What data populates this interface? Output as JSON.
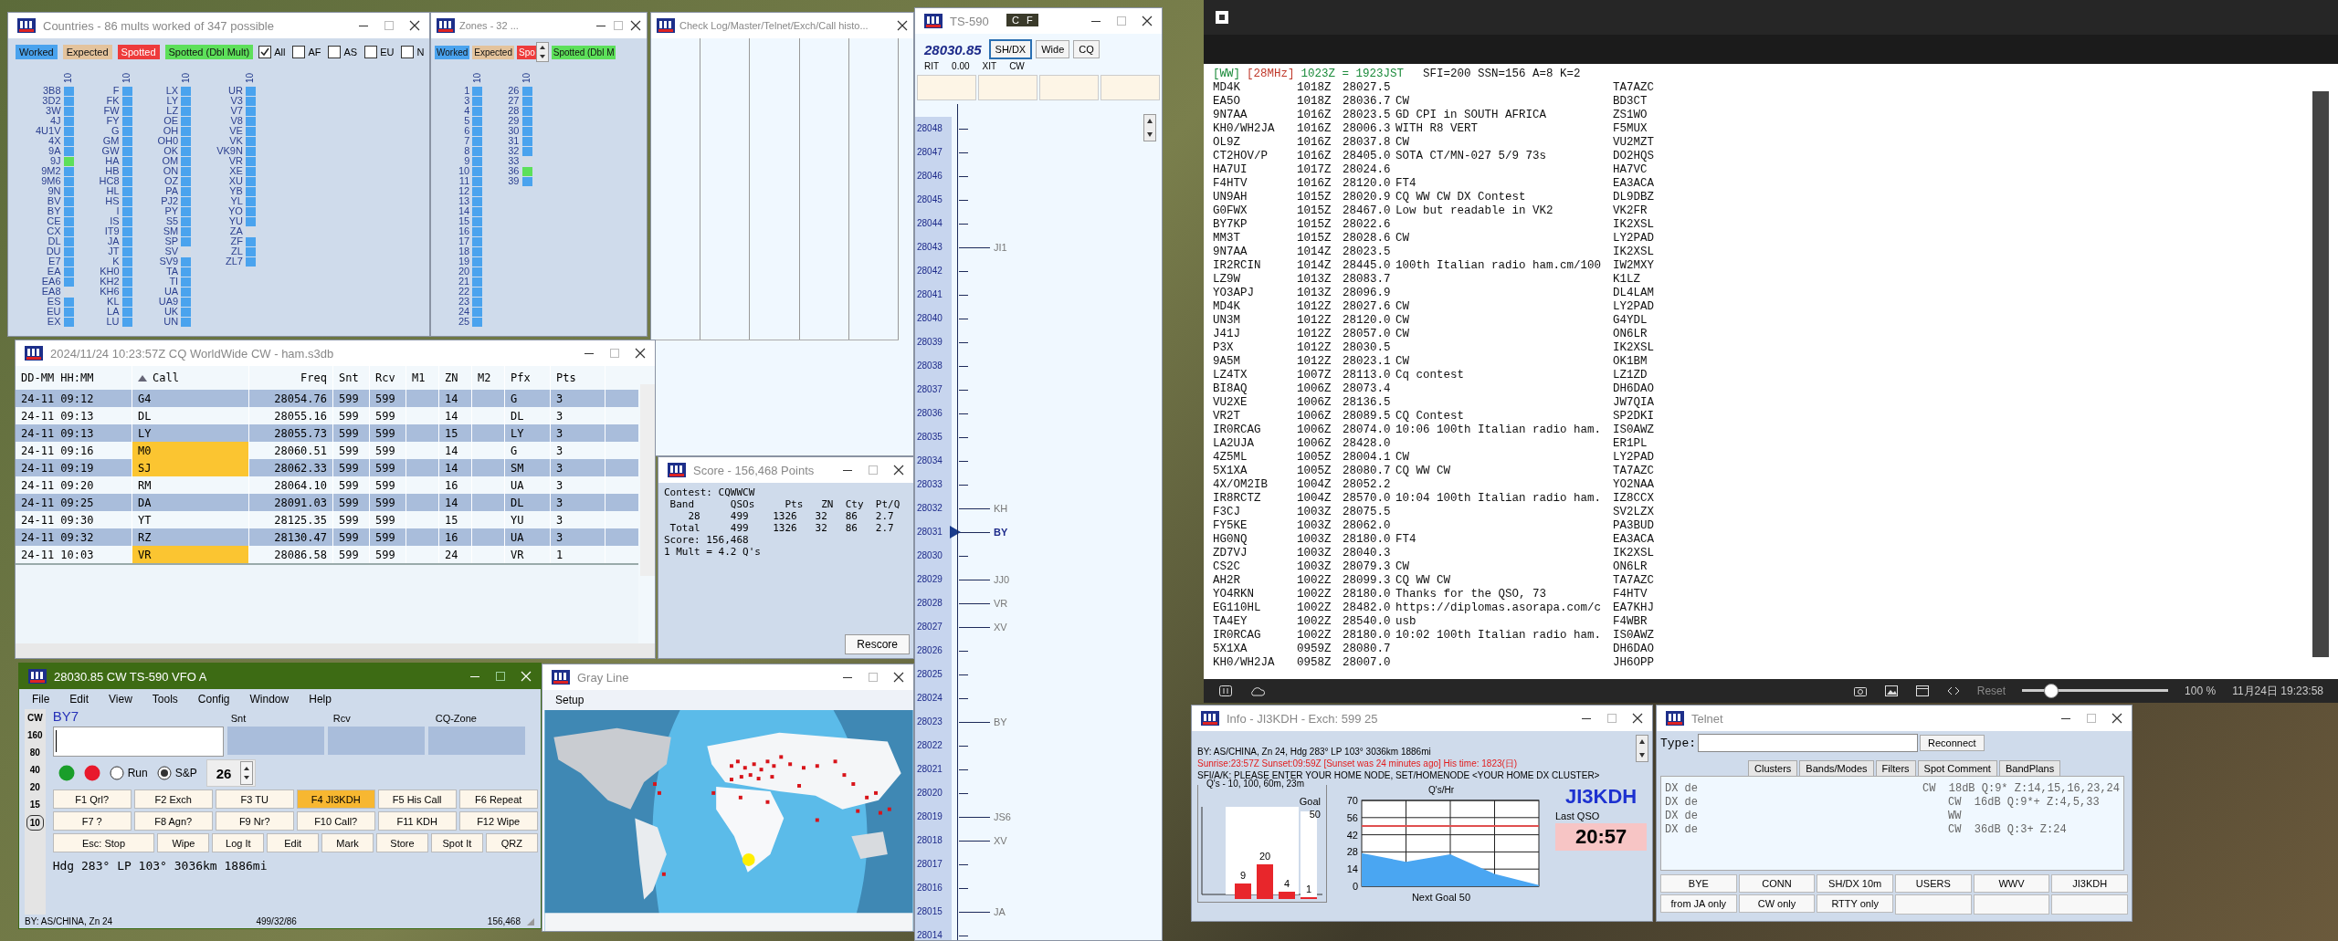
{
  "countries_window": {
    "title": "Countries - 86 mults worked of 347 possible",
    "active": false,
    "legend": [
      {
        "label": "Worked",
        "kind": "worked"
      },
      {
        "label": "Expected",
        "kind": "expected"
      },
      {
        "label": "Spotted",
        "kind": "spotted"
      },
      {
        "label": "Spotted (Dbl Mult)",
        "kind": "spotted_dbl"
      }
    ],
    "filters": [
      {
        "label": "All",
        "checked": true
      },
      {
        "label": "AF",
        "checked": false
      },
      {
        "label": "AS",
        "checked": false
      },
      {
        "label": "EU",
        "checked": false
      },
      {
        "label": "N",
        "checked": false
      }
    ],
    "columns": [
      {
        "header": "10",
        "items": [
          {
            "name": "3B8",
            "color": "#4aa3ee"
          },
          {
            "name": "3D2",
            "color": "#4aa3ee"
          },
          {
            "name": "3W",
            "color": "#4aa3ee"
          },
          {
            "name": "4J",
            "color": "#4aa3ee"
          },
          {
            "name": "4U1V",
            "color": "#4aa3ee"
          },
          {
            "name": "4X",
            "color": "#4aa3ee"
          },
          {
            "name": "9A",
            "color": "#4aa3ee"
          },
          {
            "name": "9J",
            "color": "#5de05a"
          },
          {
            "name": "9M2",
            "color": "#4aa3ee"
          },
          {
            "name": "9M6",
            "color": "#4aa3ee"
          },
          {
            "name": "9N",
            "color": "#4aa3ee"
          },
          {
            "name": "BV",
            "color": "#4aa3ee"
          },
          {
            "name": "BY",
            "color": "#4aa3ee"
          },
          {
            "name": "CE",
            "color": "#4aa3ee"
          },
          {
            "name": "CX",
            "color": "#4aa3ee"
          },
          {
            "name": "DL",
            "color": "#4aa3ee"
          },
          {
            "name": "DU",
            "color": "#4aa3ee"
          },
          {
            "name": "E7",
            "color": "#4aa3ee"
          },
          {
            "name": "EA",
            "color": "#4aa3ee"
          },
          {
            "name": "EA6",
            "color": "#4aa3ee"
          },
          {
            "name": "EA8",
            "color": "#d3dbe6"
          },
          {
            "name": "ES",
            "color": "#4aa3ee"
          },
          {
            "name": "EU",
            "color": "#4aa3ee"
          },
          {
            "name": "EX",
            "color": "#4aa3ee"
          }
        ]
      },
      {
        "header": "10",
        "items": [
          {
            "name": "F",
            "color": "#4aa3ee"
          },
          {
            "name": "FK",
            "color": "#4aa3ee"
          },
          {
            "name": "FW",
            "color": "#4aa3ee"
          },
          {
            "name": "FY",
            "color": "#4aa3ee"
          },
          {
            "name": "G",
            "color": "#4aa3ee"
          },
          {
            "name": "GM",
            "color": "#4aa3ee"
          },
          {
            "name": "GW",
            "color": "#4aa3ee"
          },
          {
            "name": "HA",
            "color": "#4aa3ee"
          },
          {
            "name": "HB",
            "color": "#4aa3ee"
          },
          {
            "name": "HC8",
            "color": "#4aa3ee"
          },
          {
            "name": "HL",
            "color": "#4aa3ee"
          },
          {
            "name": "HS",
            "color": "#4aa3ee"
          },
          {
            "name": "I",
            "color": "#4aa3ee"
          },
          {
            "name": "IS",
            "color": "#4aa3ee"
          },
          {
            "name": "IT9",
            "color": "#4aa3ee"
          },
          {
            "name": "JA",
            "color": "#4aa3ee"
          },
          {
            "name": "JT",
            "color": "#4aa3ee"
          },
          {
            "name": "K",
            "color": "#4aa3ee"
          },
          {
            "name": "KH0",
            "color": "#4aa3ee"
          },
          {
            "name": "KH2",
            "color": "#4aa3ee"
          },
          {
            "name": "KH6",
            "color": "#4aa3ee"
          },
          {
            "name": "KL",
            "color": "#4aa3ee"
          },
          {
            "name": "LA",
            "color": "#4aa3ee"
          },
          {
            "name": "LU",
            "color": "#4aa3ee"
          }
        ]
      },
      {
        "header": "10",
        "items": [
          {
            "name": "LX",
            "color": "#4aa3ee"
          },
          {
            "name": "LY",
            "color": "#4aa3ee"
          },
          {
            "name": "LZ",
            "color": "#4aa3ee"
          },
          {
            "name": "OE",
            "color": "#4aa3ee"
          },
          {
            "name": "OH",
            "color": "#4aa3ee"
          },
          {
            "name": "OH0",
            "color": "#4aa3ee"
          },
          {
            "name": "OK",
            "color": "#4aa3ee"
          },
          {
            "name": "OM",
            "color": "#4aa3ee"
          },
          {
            "name": "ON",
            "color": "#4aa3ee"
          },
          {
            "name": "OZ",
            "color": "#4aa3ee"
          },
          {
            "name": "PA",
            "color": "#4aa3ee"
          },
          {
            "name": "PJ2",
            "color": "#4aa3ee"
          },
          {
            "name": "PY",
            "color": "#4aa3ee"
          },
          {
            "name": "S5",
            "color": "#4aa3ee"
          },
          {
            "name": "SM",
            "color": "#4aa3ee"
          },
          {
            "name": "SP",
            "color": "#4aa3ee"
          },
          {
            "name": "SV",
            "color": "#d3dbe6"
          },
          {
            "name": "SV9",
            "color": "#4aa3ee"
          },
          {
            "name": "TA",
            "color": "#4aa3ee"
          },
          {
            "name": "TI",
            "color": "#4aa3ee"
          },
          {
            "name": "UA",
            "color": "#4aa3ee"
          },
          {
            "name": "UA9",
            "color": "#4aa3ee"
          },
          {
            "name": "UK",
            "color": "#4aa3ee"
          },
          {
            "name": "UN",
            "color": "#4aa3ee"
          }
        ]
      },
      {
        "header": "10",
        "items": [
          {
            "name": "UR",
            "color": "#4aa3ee"
          },
          {
            "name": "V3",
            "color": "#4aa3ee"
          },
          {
            "name": "V7",
            "color": "#4aa3ee"
          },
          {
            "name": "V8",
            "color": "#4aa3ee"
          },
          {
            "name": "VE",
            "color": "#4aa3ee"
          },
          {
            "name": "VK",
            "color": "#4aa3ee"
          },
          {
            "name": "VK9N",
            "color": "#4aa3ee"
          },
          {
            "name": "VR",
            "color": "#4aa3ee"
          },
          {
            "name": "XE",
            "color": "#4aa3ee"
          },
          {
            "name": "XU",
            "color": "#4aa3ee"
          },
          {
            "name": "YB",
            "color": "#4aa3ee"
          },
          {
            "name": "YL",
            "color": "#4aa3ee"
          },
          {
            "name": "YO",
            "color": "#4aa3ee"
          },
          {
            "name": "YU",
            "color": "#4aa3ee"
          },
          {
            "name": "ZA",
            "color": "#d3dbe6"
          },
          {
            "name": "ZF",
            "color": "#4aa3ee"
          },
          {
            "name": "ZL",
            "color": "#4aa3ee"
          },
          {
            "name": "ZL7",
            "color": "#4aa3ee"
          }
        ]
      }
    ]
  },
  "zones_window": {
    "title": "Zones - 32 ...",
    "active": false,
    "legend": [
      {
        "label": "Worked",
        "kind": "worked"
      },
      {
        "label": "Expected",
        "kind": "expected"
      },
      {
        "label": "Spo",
        "kind": "spotted"
      },
      {
        "label": "Spotted (Dbl M",
        "kind": "spotted_dbl"
      }
    ],
    "columns": [
      {
        "header": "10",
        "items": [
          {
            "name": "1",
            "color": "#4aa3ee"
          },
          {
            "name": "3",
            "color": "#4aa3ee"
          },
          {
            "name": "4",
            "color": "#4aa3ee"
          },
          {
            "name": "5",
            "color": "#4aa3ee"
          },
          {
            "name": "6",
            "color": "#4aa3ee"
          },
          {
            "name": "7",
            "color": "#4aa3ee"
          },
          {
            "name": "8",
            "color": "#4aa3ee"
          },
          {
            "name": "9",
            "color": "#4aa3ee"
          },
          {
            "name": "10",
            "color": "#4aa3ee"
          },
          {
            "name": "11",
            "color": "#4aa3ee"
          },
          {
            "name": "12",
            "color": "#4aa3ee"
          },
          {
            "name": "13",
            "color": "#4aa3ee"
          },
          {
            "name": "14",
            "color": "#4aa3ee"
          },
          {
            "name": "15",
            "color": "#4aa3ee"
          },
          {
            "name": "16",
            "color": "#4aa3ee"
          },
          {
            "name": "17",
            "color": "#4aa3ee"
          },
          {
            "name": "18",
            "color": "#4aa3ee"
          },
          {
            "name": "19",
            "color": "#4aa3ee"
          },
          {
            "name": "20",
            "color": "#4aa3ee"
          },
          {
            "name": "21",
            "color": "#4aa3ee"
          },
          {
            "name": "22",
            "color": "#4aa3ee"
          },
          {
            "name": "23",
            "color": "#4aa3ee"
          },
          {
            "name": "24",
            "color": "#4aa3ee"
          },
          {
            "name": "25",
            "color": "#4aa3ee"
          }
        ]
      },
      {
        "header": "10",
        "items": [
          {
            "name": "26",
            "color": "#4aa3ee"
          },
          {
            "name": "27",
            "color": "#4aa3ee"
          },
          {
            "name": "28",
            "color": "#4aa3ee"
          },
          {
            "name": "29",
            "color": "#4aa3ee"
          },
          {
            "name": "30",
            "color": "#4aa3ee"
          },
          {
            "name": "31",
            "color": "#4aa3ee"
          },
          {
            "name": "32",
            "color": "#4aa3ee"
          },
          {
            "name": "33",
            "color": "#d3dbe6"
          },
          {
            "name": "36",
            "color": "#5de05a"
          },
          {
            "name": "39",
            "color": "#4aa3ee"
          }
        ]
      }
    ]
  },
  "check_log_window": {
    "title": "Check Log/Master/Telnet/Exch/Call histo...",
    "active": false
  },
  "log_window": {
    "title": "2024/11/24 10:23:57Z  CQ WorldWide CW - ham.s3db",
    "active": false,
    "columns": [
      "DD-MM HH:MM",
      "Call",
      "Freq",
      "Snt",
      "Rcv",
      "M1",
      "ZN",
      "M2",
      "Pfx",
      "Pts"
    ],
    "rows": [
      {
        "time": "24-11 09:12",
        "call": "G4",
        "highlighted": false,
        "freq": "28054.76",
        "snt": "599",
        "rcv": "599",
        "zn": "14",
        "pfx": "G",
        "pts": "3"
      },
      {
        "time": "24-11 09:13",
        "call": "DL",
        "highlighted": false,
        "freq": "28055.16",
        "snt": "599",
        "rcv": "599",
        "zn": "14",
        "pfx": "DL",
        "pts": "3"
      },
      {
        "time": "24-11 09:13",
        "call": "LY",
        "highlighted": false,
        "freq": "28055.73",
        "snt": "599",
        "rcv": "599",
        "zn": "15",
        "pfx": "LY",
        "pts": "3"
      },
      {
        "time": "24-11 09:16",
        "call": "M0",
        "highlighted": true,
        "freq": "28060.51",
        "snt": "599",
        "rcv": "599",
        "zn": "14",
        "pfx": "G",
        "pts": "3"
      },
      {
        "time": "24-11 09:19",
        "call": "SJ",
        "highlighted": true,
        "freq": "28062.33",
        "snt": "599",
        "rcv": "599",
        "zn": "14",
        "pfx": "SM",
        "pts": "3"
      },
      {
        "time": "24-11 09:20",
        "call": "RM",
        "highlighted": false,
        "freq": "28064.10",
        "snt": "599",
        "rcv": "599",
        "zn": "16",
        "pfx": "UA",
        "pts": "3"
      },
      {
        "time": "24-11 09:25",
        "call": "DA",
        "highlighted": false,
        "freq": "28091.03",
        "snt": "599",
        "rcv": "599",
        "zn": "14",
        "pfx": "DL",
        "pts": "3"
      },
      {
        "time": "24-11 09:30",
        "call": "YT",
        "highlighted": false,
        "freq": "28125.35",
        "snt": "599",
        "rcv": "599",
        "zn": "15",
        "pfx": "YU",
        "pts": "3"
      },
      {
        "time": "24-11 09:32",
        "call": "RZ",
        "highlighted": false,
        "freq": "28130.47",
        "snt": "599",
        "rcv": "599",
        "zn": "16",
        "pfx": "UA",
        "pts": "3"
      },
      {
        "time": "24-11 10:03",
        "call": "VR",
        "highlighted": true,
        "freq": "28086.58",
        "snt": "599",
        "rcv": "599",
        "zn": "24",
        "pfx": "VR",
        "pts": "1"
      }
    ]
  },
  "score_window": {
    "title": "Score - 156,468 Points",
    "active": false,
    "lines": [
      "Contest: CQWWCW",
      " Band      QSOs     Pts   ZN  Cty  Pt/Q",
      "    28     499    1326   32   86   2.7",
      " Total     499    1326   32   86   2.7",
      "Score: 156,468",
      "1 Mult = 4.2 Q's"
    ],
    "button": "Rescore"
  },
  "entry_window": {
    "title": "28030.85 CW TS-590 VFO A",
    "active": true,
    "menu": [
      "File",
      "Edit",
      "View",
      "Tools",
      "Config",
      "Window",
      "Help"
    ],
    "bands": [
      {
        "label": "CW",
        "selected": false
      },
      {
        "label": "160",
        "selected": false
      },
      {
        "label": "80",
        "selected": false
      },
      {
        "label": "40",
        "selected": false
      },
      {
        "label": "20",
        "selected": false
      },
      {
        "label": "15",
        "selected": false
      },
      {
        "label": "10",
        "selected": true
      }
    ],
    "call_label": "BY7",
    "field_labels": [
      "Snt",
      "Rcv",
      "CQ-Zone"
    ],
    "lights": [
      {
        "color": "#1a9e2a"
      },
      {
        "color": "#e8192c"
      }
    ],
    "modes": [
      {
        "label": "Run",
        "selected": false
      },
      {
        "label": "S&P",
        "selected": true
      }
    ],
    "spinner": "26",
    "key_rows": [
      {
        "keys": [
          {
            "label": "F1 Qrl?",
            "highlighted": false
          },
          {
            "label": "F2 Exch",
            "highlighted": false
          },
          {
            "label": "F3 TU",
            "highlighted": false
          },
          {
            "label": "F4 JI3KDH",
            "highlighted": true
          },
          {
            "label": "F5 His Call",
            "highlighted": false
          },
          {
            "label": "F6 Repeat",
            "highlighted": false
          }
        ]
      },
      {
        "keys": [
          {
            "label": "F7 ?",
            "highlighted": false
          },
          {
            "label": "F8 Agn?",
            "highlighted": false
          },
          {
            "label": "F9 Nr?",
            "highlighted": false
          },
          {
            "label": "F10 Call?",
            "highlighted": false
          },
          {
            "label": "F11 KDH",
            "highlighted": false
          },
          {
            "label": "F12 Wipe",
            "highlighted": false
          }
        ]
      },
      {
        "keys": [
          {
            "label": "Esc: Stop",
            "highlighted": false
          },
          {
            "label": "Wipe",
            "highlighted": false
          },
          {
            "label": "Log It",
            "highlighted": false
          },
          {
            "label": "Edit",
            "highlighted": false
          },
          {
            "label": "Mark",
            "highlighted": false
          },
          {
            "label": "Store",
            "highlighted": false
          },
          {
            "label": "Spot It",
            "highlighted": false
          },
          {
            "label": "QRZ",
            "highlighted": false
          }
        ]
      }
    ],
    "heading": "Hdg 283° LP 103° 3036km 1886mi",
    "status": [
      "BY: AS/CHINA, Zn 24",
      "499/32/86",
      "156,468"
    ]
  },
  "grayline_window": {
    "title": "Gray Line",
    "active": false,
    "menu": [
      "Setup"
    ]
  },
  "bandmap_window": {
    "title": "TS-590",
    "active": false,
    "tooltip": [
      "C",
      "F"
    ],
    "freq": "28030.85",
    "buttons": [
      {
        "label": "SH/DX",
        "selected": true
      },
      {
        "label": "Wide",
        "selected": false
      },
      {
        "label": "CQ",
        "selected": false
      }
    ],
    "rit": [
      "RIT",
      "0.00",
      "XIT",
      "CW"
    ],
    "ticks": [
      {
        "freq": "28048"
      },
      {
        "freq": "28047"
      },
      {
        "freq": "28046"
      },
      {
        "freq": "28045"
      },
      {
        "freq": "28044"
      },
      {
        "freq": "28043",
        "spot": "JI1",
        "current": false
      },
      {
        "freq": "28042"
      },
      {
        "freq": "28041"
      },
      {
        "freq": "28040"
      },
      {
        "freq": "28039"
      },
      {
        "freq": "28038"
      },
      {
        "freq": "28037"
      },
      {
        "freq": "28036"
      },
      {
        "freq": "28035"
      },
      {
        "freq": "28034"
      },
      {
        "freq": "28033"
      },
      {
        "freq": "28032",
        "spot": "KH",
        "current": false
      },
      {
        "freq": "28031",
        "spot": "BY",
        "current": true
      },
      {
        "freq": "28030"
      },
      {
        "freq": "28029",
        "spot": "JJ0",
        "current": false
      },
      {
        "freq": "28028",
        "spot": "VR",
        "current": false
      },
      {
        "freq": "28027",
        "spot": "XV",
        "current": false
      },
      {
        "freq": "28026"
      },
      {
        "freq": "28025"
      },
      {
        "freq": "28024"
      },
      {
        "freq": "28023",
        "spot": "BY",
        "current": false
      },
      {
        "freq": "28022"
      },
      {
        "freq": "28021"
      },
      {
        "freq": "28020"
      },
      {
        "freq": "28019",
        "spot": "JS6",
        "current": false
      },
      {
        "freq": "28018",
        "spot": "XV",
        "current": false
      },
      {
        "freq": "28017"
      },
      {
        "freq": "28016"
      },
      {
        "freq": "28015",
        "spot": "JA",
        "current": false
      },
      {
        "freq": "28014"
      }
    ]
  },
  "spots_window": {
    "header": {
      "tag": "[WW]",
      "band": "[28MHz]",
      "time": "1023Z = 1923JST",
      "solar": "SFI=200 SSN=156 A=8 K=2"
    },
    "rows": [
      {
        "call": "MD4K",
        "time": "1018Z",
        "freq": "28027.5",
        "spotter": "TA7AZC"
      },
      {
        "call": "EA5O",
        "time": "1018Z",
        "freq": "28036.7",
        "comment": "CW",
        "spotter": "BD3CT"
      },
      {
        "call": "9N7AA",
        "time": "1016Z",
        "freq": "28023.5",
        "comment": "GD CPI in SOUTH AFRICA",
        "spotter": "ZS1WO"
      },
      {
        "call": "KH0/WH2JA",
        "time": "1016Z",
        "freq": "28006.3",
        "comment": "WITH R8 VERT",
        "spotter": "F5MUX"
      },
      {
        "call": "OL9Z",
        "time": "1016Z",
        "freq": "28037.8",
        "comment": "CW",
        "spotter": "VU2MZT"
      },
      {
        "call": "CT2HOV/P",
        "time": "1016Z",
        "freq": "28405.0",
        "comment": "SOTA CT/MN-027 5/9 73s",
        "spotter": "DO2HQS"
      },
      {
        "call": "HA7UI",
        "time": "1017Z",
        "freq": "28024.6",
        "spotter": "HA7VC"
      },
      {
        "call": "F4HTV",
        "time": "1016Z",
        "freq": "28120.0",
        "comment": "FT4",
        "spotter": "EA3ACA"
      },
      {
        "call": "UN9AH",
        "time": "1015Z",
        "freq": "28020.9",
        "comment": "CQ WW CW DX Contest",
        "spotter": "DL9DBZ"
      },
      {
        "call": "G0FWX",
        "time": "1015Z",
        "freq": "28467.0",
        "comment": "Low but readable in VK2",
        "spotter": "VK2FR"
      },
      {
        "call": "BY7KP",
        "time": "1015Z",
        "freq": "28022.6",
        "spotter": "IK2XSL"
      },
      {
        "call": "MM3T",
        "time": "1015Z",
        "freq": "28028.6",
        "comment": "CW",
        "spotter": "LY2PAD"
      },
      {
        "call": "9N7AA",
        "time": "1014Z",
        "freq": "28023.5",
        "spotter": "IK2XSL"
      },
      {
        "call": "IR2RCIN",
        "time": "1014Z",
        "freq": "28445.0",
        "comment": "100th Italian radio ham.cm/100",
        "spotter": "IW2MXY"
      },
      {
        "call": "LZ9W",
        "time": "1013Z",
        "freq": "28083.7",
        "spotter": "K1LZ"
      },
      {
        "call": "YO3APJ",
        "time": "1013Z",
        "freq": "28096.9",
        "spotter": "DL4LAM"
      },
      {
        "call": "MD4K",
        "time": "1012Z",
        "freq": "28027.6",
        "comment": "CW",
        "spotter": "LY2PAD"
      },
      {
        "call": "UN3M",
        "time": "1012Z",
        "freq": "28120.0",
        "comment": "CW",
        "spotter": "G4YDL"
      },
      {
        "call": "J41J",
        "time": "1012Z",
        "freq": "28057.0",
        "comment": "CW",
        "spotter": "ON6LR"
      },
      {
        "call": "P3X",
        "time": "1012Z",
        "freq": "28030.5",
        "spotter": "IK2XSL"
      },
      {
        "call": "9A5M",
        "time": "1012Z",
        "freq": "28023.1",
        "comment": "CW",
        "spotter": "OK1BM"
      },
      {
        "call": "LZ4TX",
        "time": "1007Z",
        "freq": "28113.0",
        "comment": "Cq contest",
        "spotter": "LZ1ZD"
      },
      {
        "call": "BI8AQ",
        "time": "1006Z",
        "freq": "28073.4",
        "spotter": "DH6DAO"
      },
      {
        "call": "VU2XE",
        "time": "1006Z",
        "freq": "28136.5",
        "spotter": "JW7QIA"
      },
      {
        "call": "VR2T",
        "time": "1006Z",
        "freq": "28089.5",
        "comment": "CQ Contest",
        "spotter": "SP2DKI"
      },
      {
        "call": "IR0RCAG",
        "time": "1006Z",
        "freq": "28074.0",
        "comment": "10:06 100th Italian radio ham.",
        "spotter": "IS0AWZ"
      },
      {
        "call": "LA2UJA",
        "time": "1006Z",
        "freq": "28428.0",
        "spotter": "ER1PL"
      },
      {
        "call": "4Z5ML",
        "time": "1005Z",
        "freq": "28004.1",
        "comment": "CW",
        "spotter": "LY2PAD"
      },
      {
        "call": "5X1XA",
        "time": "1005Z",
        "freq": "28080.7",
        "comment": "CQ WW CW",
        "spotter": "TA7AZC"
      },
      {
        "call": "4X/OM2IB",
        "time": "1004Z",
        "freq": "28052.2",
        "spotter": "YO2NAA"
      },
      {
        "call": "IR8RCTZ",
        "time": "1004Z",
        "freq": "28570.0",
        "comment": "10:04 100th Italian radio ham.",
        "spotter": "IZ8CCX"
      },
      {
        "call": "F3CJ",
        "time": "1003Z",
        "freq": "28075.5",
        "spotter": "SV2LZX"
      },
      {
        "call": "FY5KE",
        "time": "1003Z",
        "freq": "28062.0",
        "spotter": "PA3BUD"
      },
      {
        "call": "HG0NQ",
        "time": "1003Z",
        "freq": "28180.0",
        "comment": "FT4",
        "spotter": "EA3ACA"
      },
      {
        "call": "ZD7VJ",
        "time": "1003Z",
        "freq": "28040.3",
        "spotter": "IK2XSL"
      },
      {
        "call": "CS2C",
        "time": "1003Z",
        "freq": "28079.3",
        "comment": "CW",
        "spotter": "ON6LR"
      },
      {
        "call": "AH2R",
        "time": "1002Z",
        "freq": "28099.3",
        "comment": "CQ WW CW",
        "spotter": "TA7AZC"
      },
      {
        "call": "YO4RKN",
        "time": "1002Z",
        "freq": "28180.0",
        "comment": "Thanks for the QSO, 73",
        "spotter": "F4HTV"
      },
      {
        "call": "EG110HL",
        "time": "1002Z",
        "freq": "28482.0",
        "comment": "https://diplomas.asorapa.com/c",
        "spotter": "EA7KHJ"
      },
      {
        "call": "TA4EY",
        "time": "1002Z",
        "freq": "28540.0",
        "comment": "usb",
        "spotter": "F4WBR"
      },
      {
        "call": "IR0RCAG",
        "time": "1002Z",
        "freq": "28180.0",
        "comment": "10:02 100th Italian radio ham.",
        "spotter": "IS0AWZ"
      },
      {
        "call": "5X1XA",
        "time": "0959Z",
        "freq": "28080.7",
        "spotter": "DH6DAO"
      },
      {
        "call": "KH0/WH2JA",
        "time": "0958Z",
        "freq": "28007.0",
        "spotter": "JH6OPP"
      }
    ],
    "footer": {
      "reset": "Reset",
      "zoom": {
        "level": 0.2
      },
      "zoom_text": "100 %",
      "datetime": "11月24日 19:23:58"
    }
  },
  "info_window": {
    "title": "Info - JI3KDH - Exch: 599 25",
    "active": false,
    "lines": [
      {
        "text": "BY: AS/CHINA, Zn 24, Hdg 283° LP 103° 3036km 1886mi",
        "kind": "normal"
      },
      {
        "text": "Sunrise:23:57Z Sunset:09:59Z [Sunset was 24 minutes ago] His time: 1823(日)",
        "kind": "alert"
      },
      {
        "text": "SFI/A/K: PLEASE ENTER YOUR HOME NODE, SET/HOMENODE <YOUR HOME DX CLUSTER>",
        "kind": "normal"
      }
    ],
    "qs_chart": {
      "title": "Q's - 10, 100, 60m, 23m",
      "goal_label": "Goal",
      "goal_value": "50",
      "bars": [
        {
          "label": "9",
          "level": 0.18
        },
        {
          "label": "20",
          "level": 0.4
        },
        {
          "label": "4",
          "level": 0.08
        },
        {
          "label": "1",
          "level": 0.02
        }
      ]
    },
    "rate_chart": {
      "chart_data": {
        "type": "area",
        "title": "Q's/Hr",
        "xlabel": "Next Goal 50",
        "categories": [
          null,
          null,
          null,
          null,
          null
        ],
        "values": [
          27,
          20,
          26,
          10,
          1
        ],
        "ylim": [
          0,
          70
        ],
        "yticks": [
          0,
          14,
          28,
          42,
          56,
          70
        ],
        "grid": true
      }
    },
    "call": "JI3KDH",
    "last_qso_label": "Last QSO",
    "last_qso": "20:57"
  },
  "telnet_window": {
    "title": "Telnet",
    "active": false,
    "type_label": "Type:",
    "reconnect": "Reconnect",
    "tabs": [
      {
        "label": "Clusters",
        "selected": false
      },
      {
        "label": "Bands/Modes",
        "selected": false
      },
      {
        "label": "Filters",
        "selected": false
      },
      {
        "label": "Spot Comment",
        "selected": false
      },
      {
        "label": "BandPlans",
        "selected": false
      }
    ],
    "lines": [
      {
        "prefix": "DX de",
        "info": "CW  18dB Q:9* Z:14,15,16,23,24"
      },
      {
        "prefix": "DX de",
        "info": "CW  16dB Q:9*+ Z:4,5,33"
      },
      {
        "prefix": "DX de",
        "info": "WW"
      },
      {
        "prefix": "DX de",
        "info": "CW  36dB Q:3+ Z:24"
      }
    ],
    "button_rows": [
      {
        "labels": [
          "BYE",
          "CONN",
          "SH/DX 10m",
          "USERS",
          "WWV",
          "JI3KDH"
        ]
      },
      {
        "labels": [
          "from JA only",
          "CW only",
          "RTTY only"
        ]
      }
    ]
  }
}
